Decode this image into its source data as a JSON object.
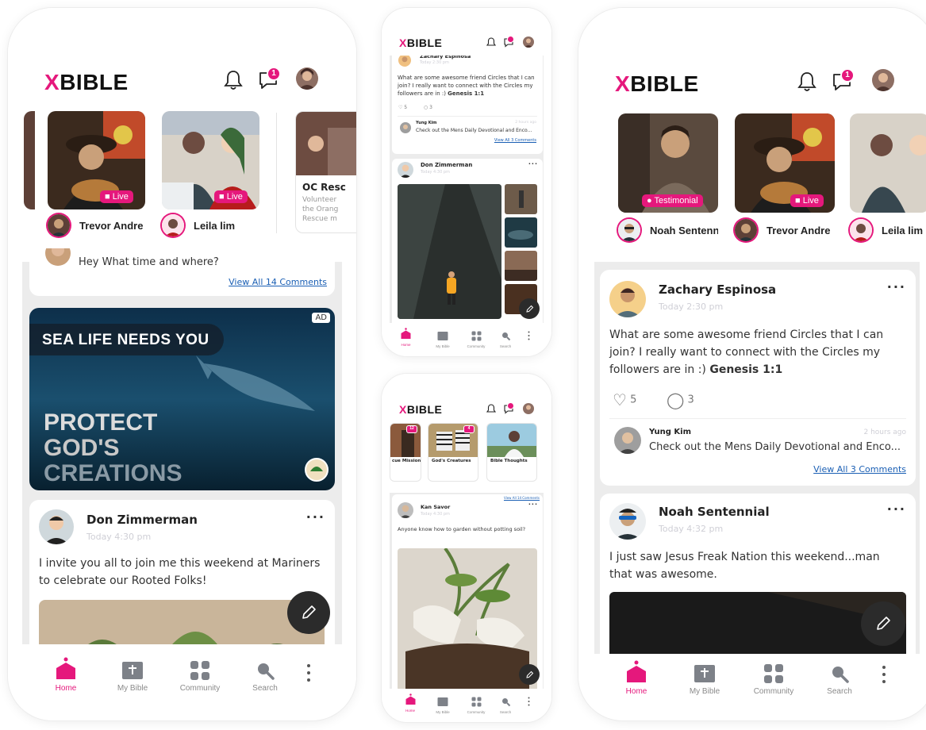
{
  "brand": {
    "x": "X",
    "rest": "BIBLE"
  },
  "colors": {
    "accent": "#e5187c",
    "link": "#1a5fb4",
    "muted": "#c8c8d0",
    "bg": "#ececec"
  },
  "header": {
    "notif_count": "1"
  },
  "nav": [
    {
      "label": "Home",
      "icon": "home-icon",
      "active": true
    },
    {
      "label": "My Bible",
      "icon": "bible-icon"
    },
    {
      "label": "Community",
      "icon": "grid-icon"
    },
    {
      "label": "Search",
      "icon": "search-icon"
    }
  ],
  "screenA": {
    "stories": [
      {
        "name": "Trevor Andrews",
        "tag": "Live"
      },
      {
        "name": "Leila lim",
        "tag": "Live"
      },
      {
        "title": "OC Resc",
        "desc": "Volunteer the Orang Rescue m"
      }
    ],
    "comment": {
      "text": "Hey What time and where?",
      "view_all": "View All 14 Comments"
    },
    "ad": {
      "label": "AD",
      "headline": "SEA LIFE NEEDS YOU",
      "line1": "PROTECT",
      "line2": "GOD'S",
      "line3": "CREATIONS"
    },
    "post": {
      "author": "Don Zimmerman",
      "time": "Today 4:30 pm",
      "text1": "I invite you all to join me this weekend at Mariners",
      "text2": "to  celebrate our Rooted Folks!",
      "more": "···"
    }
  },
  "screenB": {
    "post1": {
      "author": "Zachary Espinosa",
      "time": "Today 2:30 pm",
      "text1": "What are some awesome friend Circles that I can",
      "text2": "join? I really want to connect with the Circles my",
      "text3": "followers are in :) ",
      "verse": "Genesis 1:1",
      "likes": "5",
      "comments": "3",
      "reply": {
        "author": "Yung Kim",
        "time": "2 hours ago",
        "text": "Check out the Mens Daily Devotional and Enco...",
        "view_all": "View All 3 Comments"
      }
    },
    "post2": {
      "author": "Don Zimmerman",
      "time": "Today 4:30 pm",
      "more": "···"
    }
  },
  "screenC": {
    "circles": [
      {
        "title": "cue Mission",
        "count": "12"
      },
      {
        "title": "God's Creatures",
        "count": "4"
      },
      {
        "title": "Bible Thoughts"
      }
    ],
    "strip_link": "View All 14 Comments",
    "post": {
      "author": "Kan Savor",
      "time": "Today 4:30 pm",
      "text": "Anyone know how to garden without potting soil?",
      "more": "···"
    }
  },
  "screenD": {
    "stories": [
      {
        "name": "Noah Sentennial",
        "tag": "Testimonial"
      },
      {
        "name": "Trevor Andrews",
        "tag": "Live"
      },
      {
        "name": "Leila lim"
      }
    ],
    "post1": {
      "author": "Zachary Espinosa",
      "time": "Today 2:30 pm",
      "text1": "What are some awesome friend Circles that I can",
      "text2": "join? I really want to connect with the Circles my",
      "text3": "followers are in :) ",
      "verse": "Genesis 1:1",
      "likes": "5",
      "comments": "3",
      "more": "···",
      "reply": {
        "author": "Yung Kim",
        "time": "2 hours ago",
        "text": "Check out the Mens Daily Devotional and Enco...",
        "view_all": "View All 3 Comments"
      }
    },
    "post2": {
      "author": "Noah Sentennial",
      "time": "Today 4:32 pm",
      "text1": "I just saw Jesus Freak Nation this weekend...man",
      "text2": "that was awesome.",
      "more": "···"
    }
  }
}
